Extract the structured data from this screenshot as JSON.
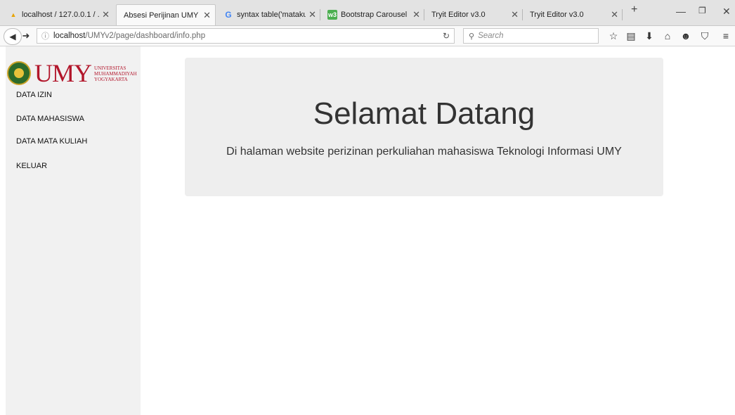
{
  "browser": {
    "tabs": [
      {
        "title": "localhost / 127.0.0.1 / ...",
        "favicon": "phpmyadmin-icon"
      },
      {
        "title": "Absesi Perijinan UMY",
        "favicon": "none",
        "active": true
      },
      {
        "title": "syntax table('matakuli...",
        "favicon": "google-icon"
      },
      {
        "title": "Bootstrap Carousel",
        "favicon": "w3schools-icon"
      },
      {
        "title": "Tryit Editor v3.0",
        "favicon": "none"
      },
      {
        "title": "Tryit Editor v3.0",
        "favicon": "none"
      }
    ],
    "url_host": "localhost",
    "url_path": "/UMYv2/page/dashboard/info.php",
    "search_placeholder": "Search"
  },
  "sidebar": {
    "logo_word": "UMY",
    "logo_sub_1": "UNIVERSITAS",
    "logo_sub_2": "MUHAMMADIYAH",
    "logo_sub_3": "YOGYAKARTA",
    "menu": [
      {
        "label": "DATA IZIN"
      },
      {
        "label": "DATA MAHASISWA"
      },
      {
        "label": "DATA MATA KULIAH"
      },
      {
        "label": "KELUAR"
      }
    ]
  },
  "main": {
    "heading": "Selamat Datang",
    "lead": "Di halaman website perizinan perkuliahan mahasiswa Teknologi Informasi UMY"
  },
  "colors": {
    "brand_red": "#b2162b",
    "sidebar_bg": "#f1f1f1",
    "jumbotron_bg": "#eeeeee"
  }
}
